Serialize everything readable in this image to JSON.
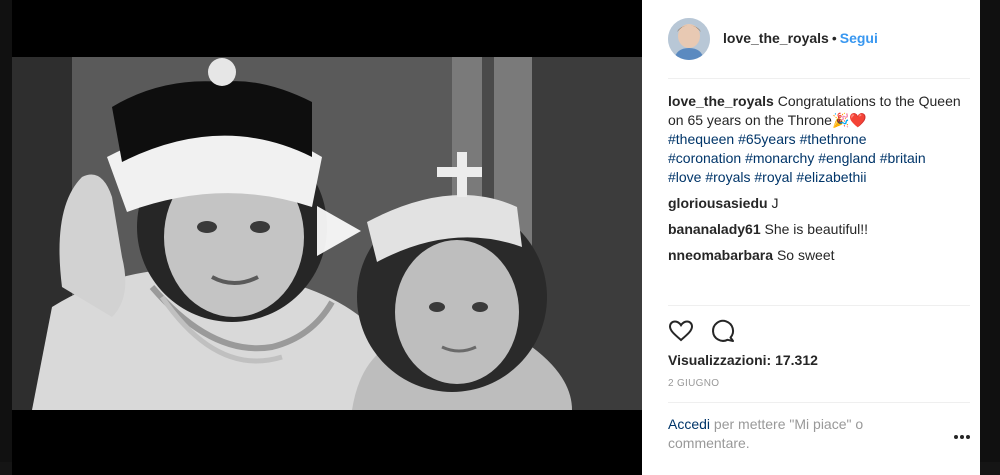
{
  "post": {
    "username": "love_the_royals",
    "separator": "•",
    "follow_label": "Segui",
    "caption": {
      "user": "love_the_royals",
      "text": "Congratulations to the Queen on 65 years on the Throne🎉❤️",
      "hashtags": [
        "#thequeen",
        "#65years",
        "#thethrone",
        "#coronation",
        "#monarchy",
        "#england",
        "#britain",
        "#love",
        "#royals",
        "#royal",
        "#elizabethii"
      ]
    },
    "comments": [
      {
        "user": "gloriousasiedu",
        "text": "J"
      },
      {
        "user": "bananalady61",
        "text": "She is beautiful!!"
      },
      {
        "user": "nneomabarbara",
        "text": "So sweet"
      }
    ],
    "views": "Visualizzazioni: 17.312",
    "date": "2 GIUGNO",
    "login": {
      "link": "Accedi",
      "text": "per mettere \"Mi piace\" o commentare."
    }
  },
  "icons": {
    "like": "heart-icon",
    "comment": "comment-icon",
    "more": "more-options-icon",
    "play": "play-icon"
  },
  "colors": {
    "follow": "#3897f0",
    "hashtag": "#003569",
    "muted": "#999999",
    "text": "#262626"
  }
}
